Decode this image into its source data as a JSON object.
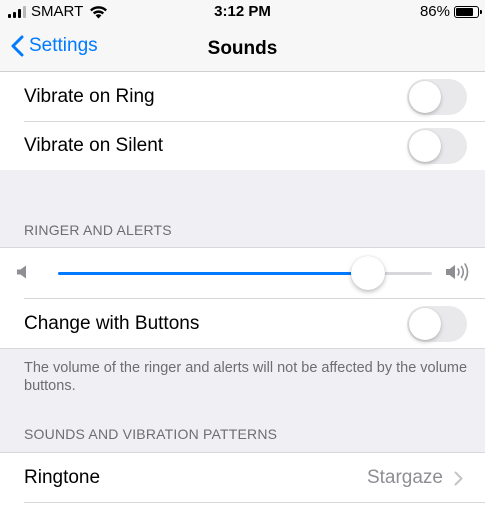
{
  "status_bar": {
    "carrier": "SMART",
    "time": "3:12 PM",
    "battery_percent": "86%",
    "battery_level": 0.86
  },
  "nav": {
    "back_label": "Settings",
    "title": "Sounds"
  },
  "vibrate": {
    "ring_label": "Vibrate on Ring",
    "ring_on": false,
    "silent_label": "Vibrate on Silent",
    "silent_on": false
  },
  "ringer": {
    "header": "RINGER AND ALERTS",
    "volume_level": 0.83,
    "change_with_buttons_label": "Change with Buttons",
    "change_with_buttons_on": false,
    "footer": "The volume of the ringer and alerts will not be affected by the volume buttons."
  },
  "patterns": {
    "header": "SOUNDS AND VIBRATION PATTERNS",
    "ringtone_label": "Ringtone",
    "ringtone_value": "Stargaze"
  },
  "colors": {
    "accent": "#007aff",
    "background": "#efeff4",
    "secondary_text": "#6d6d72"
  },
  "icons": [
    "cellular-signal-icon",
    "wifi-icon",
    "battery-icon",
    "chevron-left-icon",
    "volume-low-icon",
    "volume-high-icon",
    "chevron-right-icon"
  ]
}
